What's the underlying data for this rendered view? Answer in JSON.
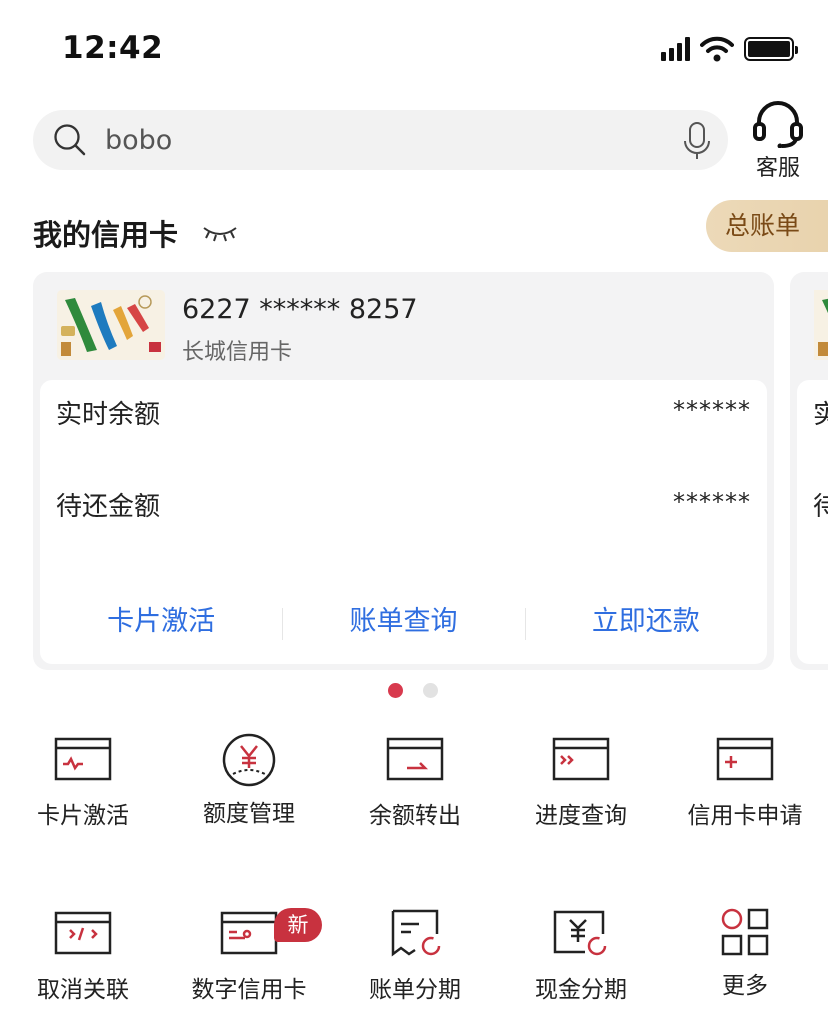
{
  "status_bar": {
    "time": "12:42"
  },
  "search": {
    "value": "bobo"
  },
  "service": {
    "label": "客服"
  },
  "section": {
    "title": "我的信用卡",
    "total_bill_label": "总账单"
  },
  "card": {
    "number": "6227 ****** 8257",
    "name": "长城信用卡",
    "rows": [
      {
        "label": "实时余额",
        "value": "******"
      },
      {
        "label": "待还金额",
        "value": "******"
      }
    ],
    "actions": [
      "卡片激活",
      "账单查询",
      "立即还款"
    ]
  },
  "card_peek": {
    "rows": [
      "实",
      "待"
    ]
  },
  "pagination": {
    "count": 2,
    "active": 0
  },
  "grid": {
    "accent_color": "#c8323f",
    "items": [
      {
        "label": "卡片激活",
        "icon": "card-activate-icon"
      },
      {
        "label": "额度管理",
        "icon": "yuan-circle-icon"
      },
      {
        "label": "余额转出",
        "icon": "card-transfer-icon"
      },
      {
        "label": "进度查询",
        "icon": "card-progress-icon"
      },
      {
        "label": "信用卡申请",
        "icon": "card-apply-icon"
      },
      {
        "label": "取消关联",
        "icon": "card-unlink-icon"
      },
      {
        "label": "数字信用卡",
        "icon": "digital-card-icon",
        "badge": "新"
      },
      {
        "label": "账单分期",
        "icon": "bill-installment-icon"
      },
      {
        "label": "现金分期",
        "icon": "cash-installment-icon"
      },
      {
        "label": "更多",
        "icon": "more-grid-icon"
      }
    ]
  }
}
